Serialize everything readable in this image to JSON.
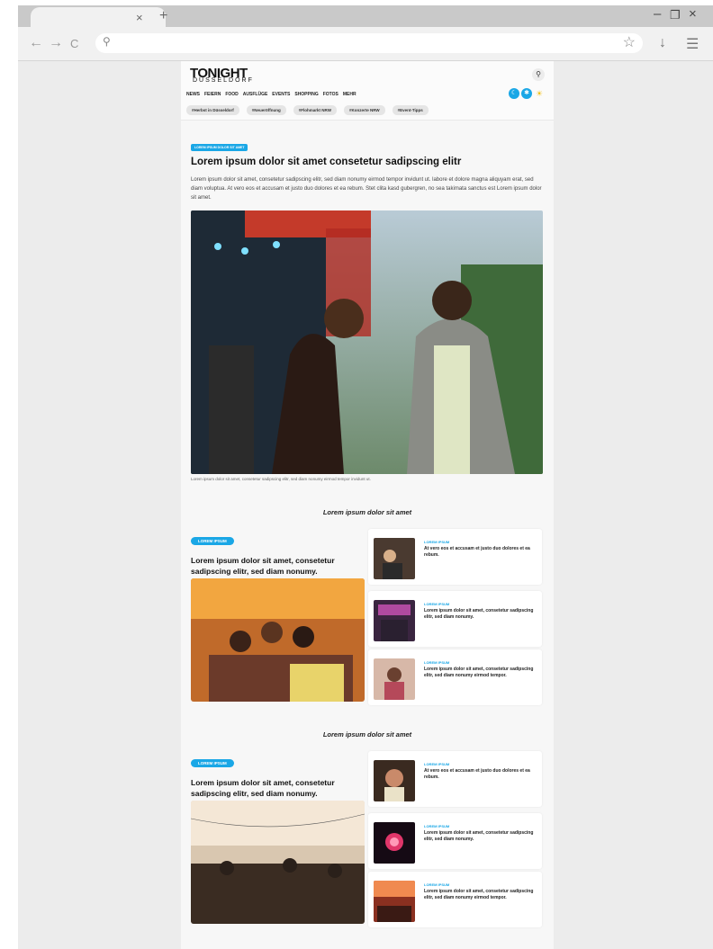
{
  "browser": {
    "tab_close": "×",
    "tab_new": "+",
    "minimize": "–",
    "restore": "❐",
    "close": "×",
    "back": "←",
    "forward": "→",
    "reload": "C",
    "search_glyph": "⚲",
    "star": "☆",
    "download": "↓",
    "menu": "☰"
  },
  "site": {
    "logo": "TONIGHT",
    "logo_sub": "DÜSSELDORF",
    "search_icon": "⚲",
    "nav": [
      "NEWS",
      "FEIERN",
      "FOOD",
      "AUSFLÜGE",
      "EVENTS",
      "SHOPPING",
      "FOTOS",
      "MEHR"
    ],
    "tags": [
      "#Herbst in Düsseldorf",
      "#Neueröffnung",
      "#Flohmarkt NRW",
      "#Konzerte NRW",
      "#Event-Tipps"
    ],
    "accent": "#1aa7e6"
  },
  "hero": {
    "badge": "LOREM IPSUM DOLOR SIT AMET",
    "title": "Lorem ipsum dolor sit amet consetetur sadipscing elitr",
    "text": "Lorem ipsum dolor sit amet, consetetur sadipscing elitr, sed diam nonumy eirmod tempor invidunt ut. labore et dolore magna aliquyam erat, sed diam voluptua. At vero eos et accusam et justo duo dolores et ea rebum. Stet clita kasd gubergren, no sea takimata sanctus est Lorem ipsum dolor sit amet.",
    "caption": "Lorem ipsum dolor sit amet, consetetur sadipscing elitr, sed diam nonumy eirmod tempor invidunt ut."
  },
  "sections": [
    {
      "title": "Lorem ipsum dolor sit amet",
      "feature_badge": "LOREM IPSUM",
      "feature_title": "Lorem ipsum dolor sit amet, consetetur sadipscing elitr, sed diam nonumy.",
      "cards": [
        {
          "kicker": "LOREM IPSUM",
          "text": "At vero eos et accusam et justo duo dolores et ea rebum."
        },
        {
          "kicker": "LOREM IPSUM",
          "text": "Lorem ipsum dolor sit amet, consetetur sadipscing elitr, sed diam nonumy."
        },
        {
          "kicker": "LOREM IPSUM",
          "text": "Lorem ipsum dolor sit amet, consetetur sadipscing elitr, sed diam nonumy eirmod tempor."
        }
      ]
    },
    {
      "title": "Lorem ipsum dolor sit amet",
      "feature_badge": "LOREM IPSUM",
      "feature_title": "Lorem ipsum dolor sit amet, consetetur sadipscing elitr, sed diam nonumy.",
      "cards": [
        {
          "kicker": "LOREM IPSUM",
          "text": "At vero eos et accusam et justo duo dolores et ea rebum."
        },
        {
          "kicker": "LOREM IPSUM",
          "text": "Lorem ipsum dolor sit amet, consetetur sadipscing elitr, sed diam nonumy."
        },
        {
          "kicker": "LOREM IPSUM",
          "text": "Lorem ipsum dolor sit amet, consetetur sadipscing elitr, sed diam nonumy eirmod tempor."
        }
      ]
    }
  ]
}
